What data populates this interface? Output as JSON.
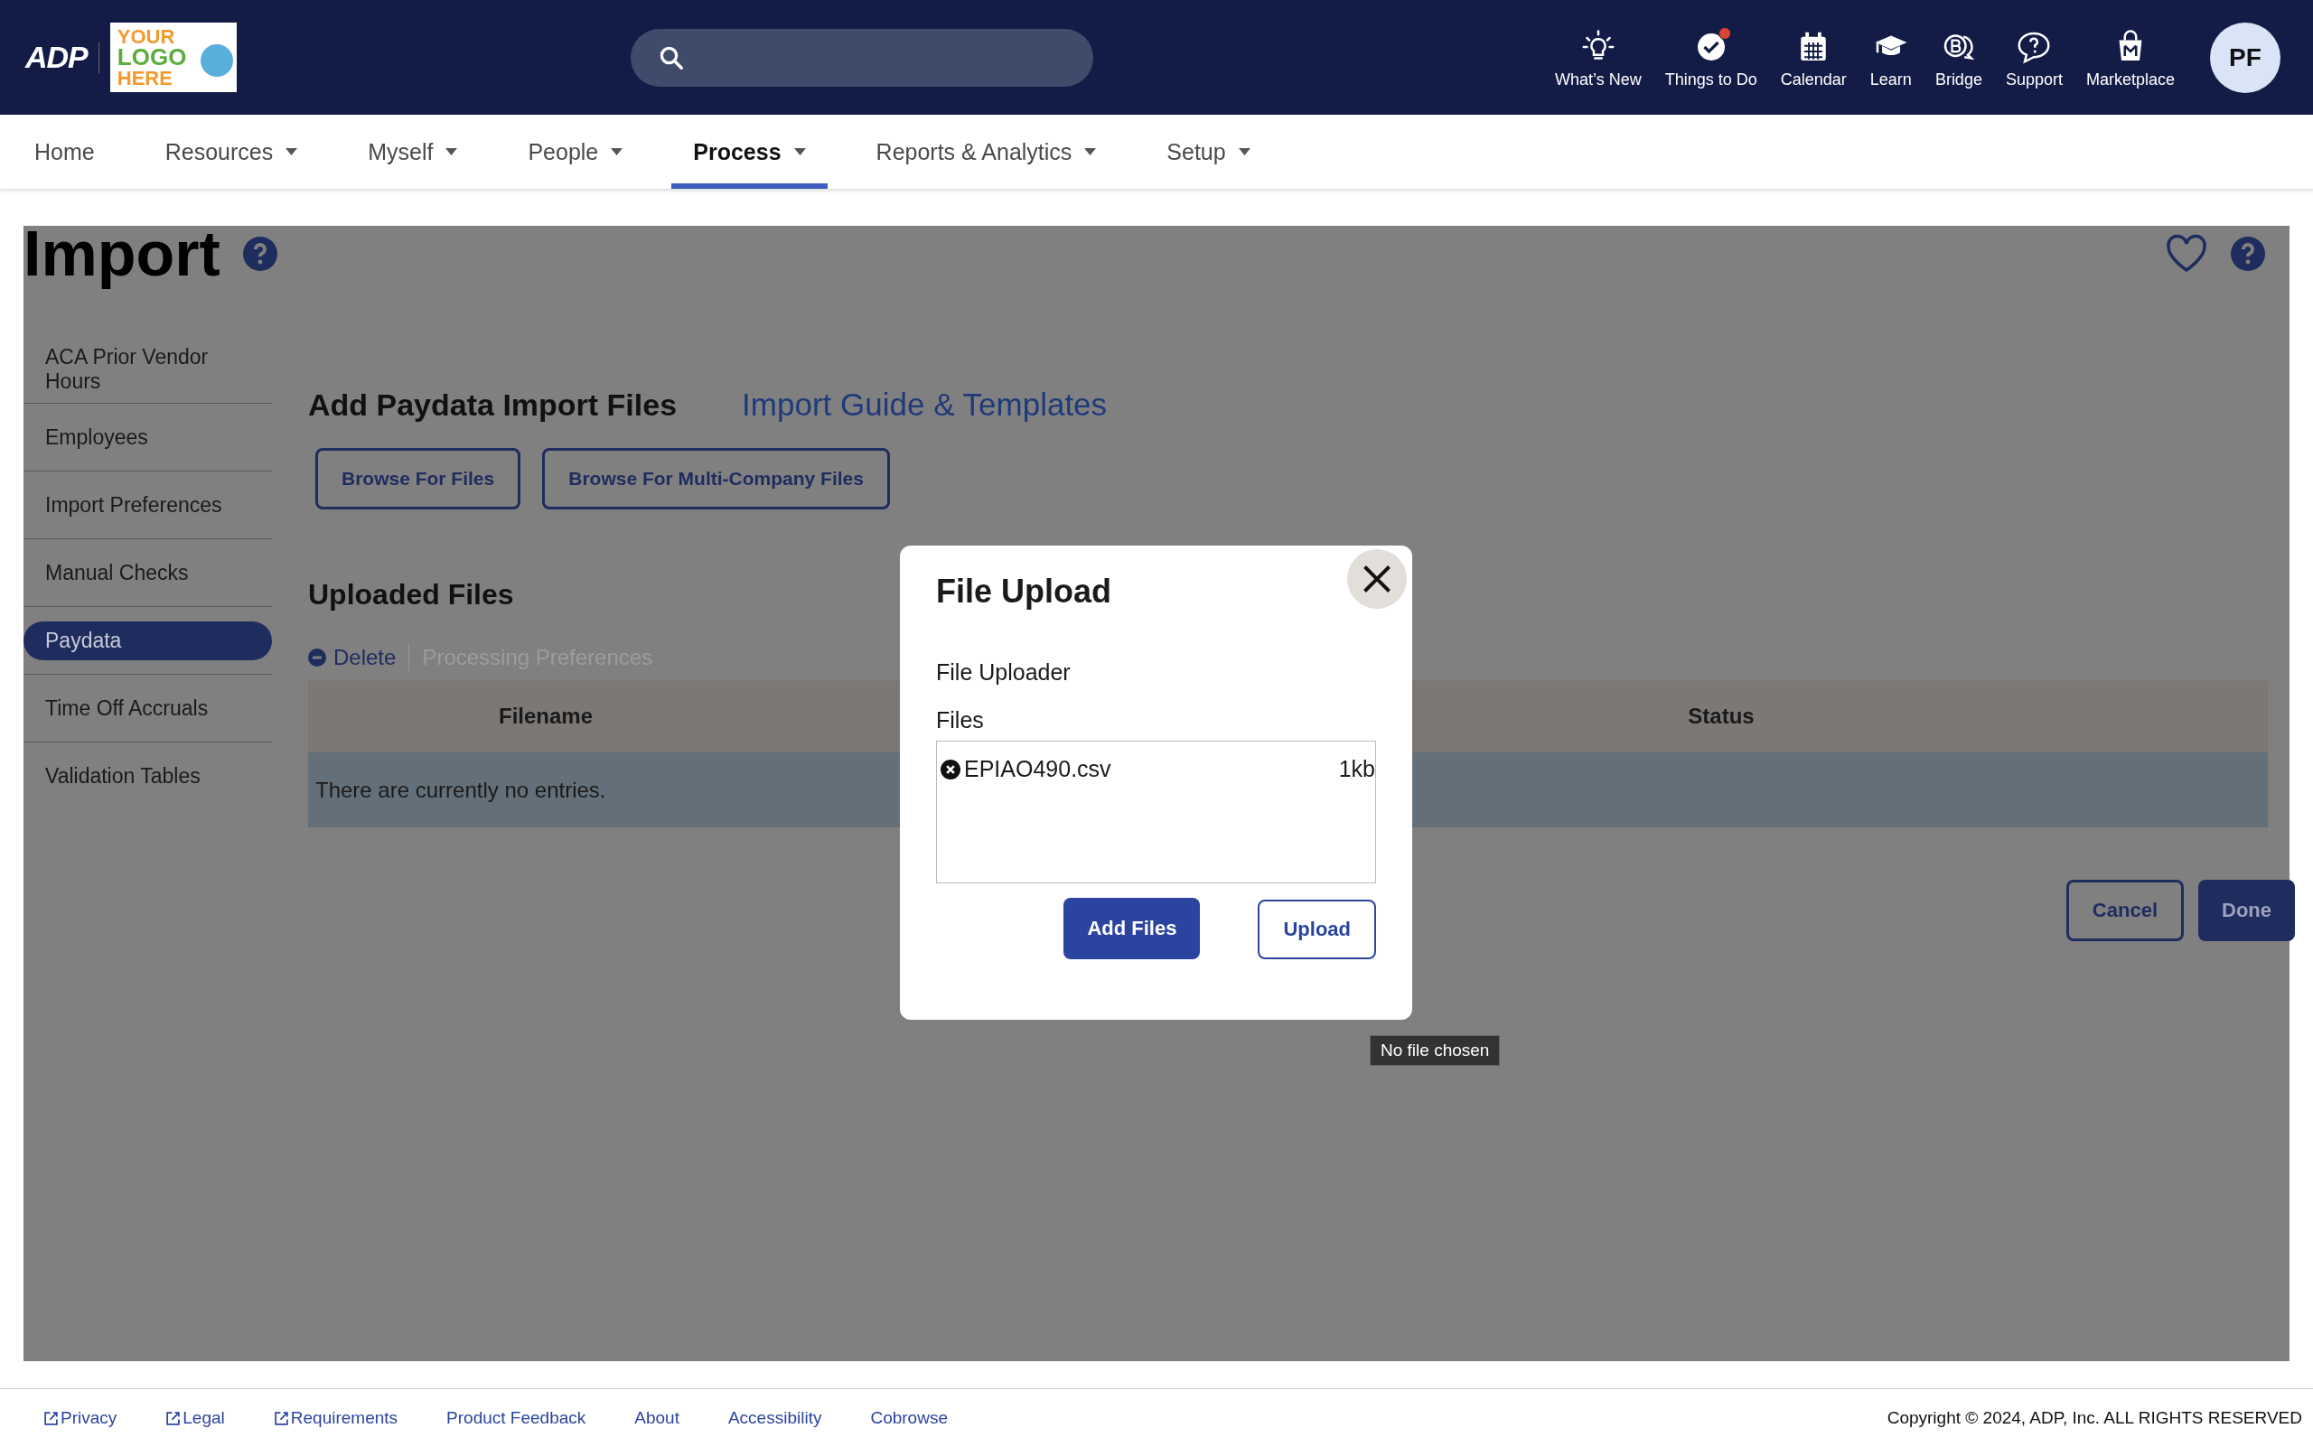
{
  "header": {
    "brand": "ADP",
    "company_logo": [
      "YOUR",
      "LOGO",
      "HERE"
    ],
    "tools": [
      {
        "label": "What’s New",
        "kind": "bulb",
        "notification": false
      },
      {
        "label": "Things to Do",
        "kind": "check",
        "notification": true
      },
      {
        "label": "Calendar",
        "kind": "calendar",
        "notification": false
      },
      {
        "label": "Learn",
        "kind": "cap",
        "notification": false
      },
      {
        "label": "Bridge",
        "kind": "bridge",
        "notification": false
      },
      {
        "label": "Support",
        "kind": "support",
        "notification": false
      },
      {
        "label": "Marketplace",
        "kind": "bag",
        "notification": false
      }
    ],
    "avatar": "PF"
  },
  "nav": [
    {
      "label": "Home",
      "dropdown": false,
      "selected": false
    },
    {
      "label": "Resources",
      "dropdown": true,
      "selected": false
    },
    {
      "label": "Myself",
      "dropdown": true,
      "selected": false
    },
    {
      "label": "People",
      "dropdown": true,
      "selected": false
    },
    {
      "label": "Process",
      "dropdown": true,
      "selected": true
    },
    {
      "label": "Reports & Analytics",
      "dropdown": true,
      "selected": false
    },
    {
      "label": "Setup",
      "dropdown": true,
      "selected": false
    }
  ],
  "page": {
    "title": "Import"
  },
  "sidebar": [
    {
      "label": "ACA Prior Vendor Hours",
      "selected": false
    },
    {
      "label": "Employees",
      "selected": false
    },
    {
      "label": "Import Preferences",
      "selected": false
    },
    {
      "label": "Manual Checks",
      "selected": false
    },
    {
      "label": "Paydata",
      "selected": true
    },
    {
      "label": "Time Off Accruals",
      "selected": false
    },
    {
      "label": "Validation Tables",
      "selected": false
    }
  ],
  "main": {
    "title": "Add Paydata Import Files",
    "guide_link": "Import Guide & Templates",
    "browse_buttons": [
      "Browse For Files",
      "Browse For Multi-Company Files"
    ],
    "uploaded_title": "Uploaded Files",
    "actions": [
      {
        "label": "Delete",
        "disabled": false
      },
      {
        "label": "Processing Preferences",
        "disabled": true
      }
    ],
    "table": {
      "columns": [
        "Filename",
        "Status"
      ],
      "empty": "There are currently no entries."
    },
    "buttons": [
      {
        "label": "Cancel",
        "kind": "secondary"
      },
      {
        "label": "Done",
        "kind": "primary"
      }
    ]
  },
  "dialog": {
    "title": "File Upload",
    "subtitle": "File Uploader",
    "files_label": "Files",
    "files": [
      {
        "name": "EPIAO490.csv",
        "size": "1kb"
      }
    ],
    "buttons": [
      {
        "label": "Add Files",
        "kind": "primary"
      },
      {
        "label": "Upload",
        "kind": "secondary"
      }
    ]
  },
  "tooltip": "No file chosen",
  "footer": {
    "links": [
      {
        "label": "Privacy",
        "external": true
      },
      {
        "label": "Legal",
        "external": true
      },
      {
        "label": "Requirements",
        "external": true
      },
      {
        "label": "Product Feedback",
        "external": false
      },
      {
        "label": "About",
        "external": false
      },
      {
        "label": "Accessibility",
        "external": false
      },
      {
        "label": "Cobrowse",
        "external": false
      }
    ],
    "copyright": "Copyright © 2024, ADP, Inc. ALL RIGHTS RESERVED"
  }
}
